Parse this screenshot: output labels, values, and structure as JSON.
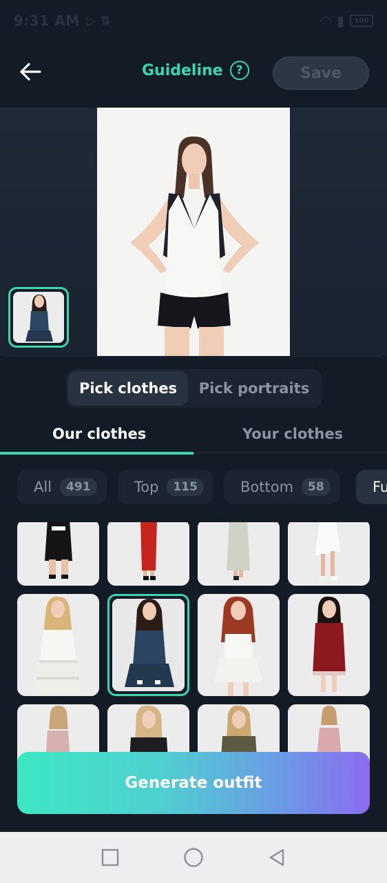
{
  "status_bar": {
    "time": "9:31 AM",
    "battery": "100"
  },
  "header": {
    "title": "Guideline",
    "help_glyph": "?",
    "save_label": "Save"
  },
  "segments": [
    {
      "label": "Pick clothes",
      "active": true
    },
    {
      "label": "Pick portraits",
      "active": false
    }
  ],
  "tabs": [
    {
      "label": "Our clothes",
      "active": true
    },
    {
      "label": "Your clothes",
      "active": false
    }
  ],
  "chips": [
    {
      "label": "All",
      "count": "491"
    },
    {
      "label": "Top",
      "count": "115"
    },
    {
      "label": "Bottom",
      "count": "58"
    },
    {
      "label": "Fu",
      "count": ""
    }
  ],
  "generate_label": "Generate outfit",
  "colors": {
    "accent": "#37d7ae",
    "background": "#131b27",
    "gradient_start": "#3ce7c2",
    "gradient_end": "#8b6cf0"
  },
  "icons": {
    "back": "arrow-left-icon",
    "help": "question-circle-icon",
    "nav_recent": "square-icon",
    "nav_home": "circle-icon",
    "nav_back": "triangle-back-icon"
  }
}
